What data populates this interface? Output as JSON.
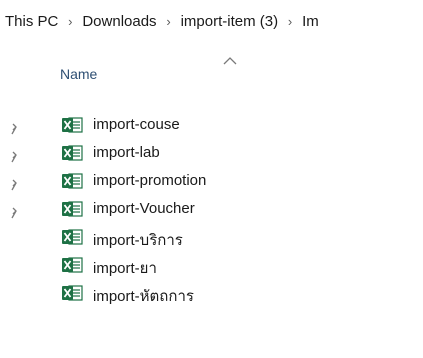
{
  "breadcrumb": {
    "items": [
      "This PC",
      "Downloads",
      "import-item (3)",
      "Im"
    ],
    "separator": "›"
  },
  "header": {
    "column_name": "Name",
    "sort_icon": "chevron-up-icon"
  },
  "files": [
    {
      "name": "import-couse",
      "icon": "excel-file-icon",
      "pinned": true
    },
    {
      "name": "import-lab",
      "icon": "excel-file-icon",
      "pinned": true
    },
    {
      "name": "import-promotion",
      "icon": "excel-file-icon",
      "pinned": true
    },
    {
      "name": "import-Voucher",
      "icon": "excel-file-icon",
      "pinned": true
    },
    {
      "name": "import-บริการ",
      "icon": "excel-file-icon",
      "pinned": false
    },
    {
      "name": "import-ยา",
      "icon": "excel-file-icon",
      "pinned": false
    },
    {
      "name": "import-หัตถการ",
      "icon": "excel-file-icon",
      "pinned": false
    }
  ],
  "colors": {
    "excel_green": "#1e7145",
    "header_text": "#2e4f73",
    "pin_gray": "#7a7a7a"
  }
}
